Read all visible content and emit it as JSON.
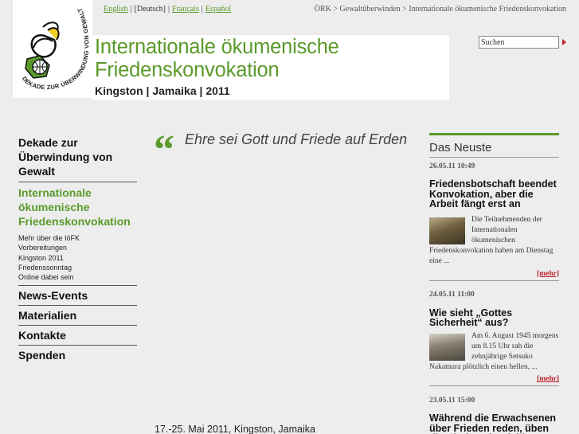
{
  "header": {
    "languages": [
      {
        "label": "English",
        "current": false
      },
      {
        "label": "[Deutsch]",
        "current": true
      },
      {
        "label": "Français",
        "current": false
      },
      {
        "label": "Español",
        "current": false
      }
    ],
    "breadcrumb": "ÖRK > Gewaltüberwinden > Internationale ökumenische Friedenskonvokation",
    "title_line1": "Internationale ökumenische",
    "title_line2": "Friedenskonvokation",
    "subtitle": "Kingston  |  Jamaika  |  2011",
    "search_value": "Suchen",
    "logo_text": "DEKADE ZUR ÜBERWINDUNG VON GEWALT",
    "accent_color": "#5a9a2a",
    "link_red": "#c0202a"
  },
  "nav": {
    "decade_line1": "Dekade zur",
    "decade_line2": "Überwindung von",
    "decade_line3": "Gewalt",
    "convocation_line1": "Internationale",
    "convocation_line2": "ökumenische",
    "convocation_line3": "Friedenskonvokation",
    "subitems": [
      "Mehr über die IöFK",
      "Vorbereitungen",
      "Kingston 2011",
      "Friedenssonntag",
      "Online dabei sein"
    ],
    "news_events": "News-Events",
    "materials": "Materialien",
    "contacts": "Kontakte",
    "donations": "Spenden"
  },
  "main": {
    "quote_mark": "“",
    "quote": "Ehre sei Gott und Friede auf Erden",
    "event_line": "17.-25. Mai 2011, Kingston, Jamaika"
  },
  "news": {
    "heading": "Das Neuste",
    "items": [
      {
        "date": "26.05.11 10:49",
        "title": "Friedensbotschaft beendet Konvokation, aber die Arbeit fängt erst an",
        "body": "Die Teilnehmenden der Internationalen ökumenischen Friedenskonvokation haben am Dienstag eine ...",
        "more": "[mehr]"
      },
      {
        "date": "24.05.11 11:00",
        "title": "Wie sieht „Gottes Sicherheit“ aus?",
        "body": "Am 6. August 1945 morgens um 8.15 Uhr sah die zehnjährige Setsuko Nakamura plötzlich einen hellen, ...",
        "more": "[mehr]"
      },
      {
        "date": "23.05.11 15:00",
        "title": "Während die Erwachsenen über Frieden reden, üben die Kinder Mitgefühl"
      }
    ]
  }
}
